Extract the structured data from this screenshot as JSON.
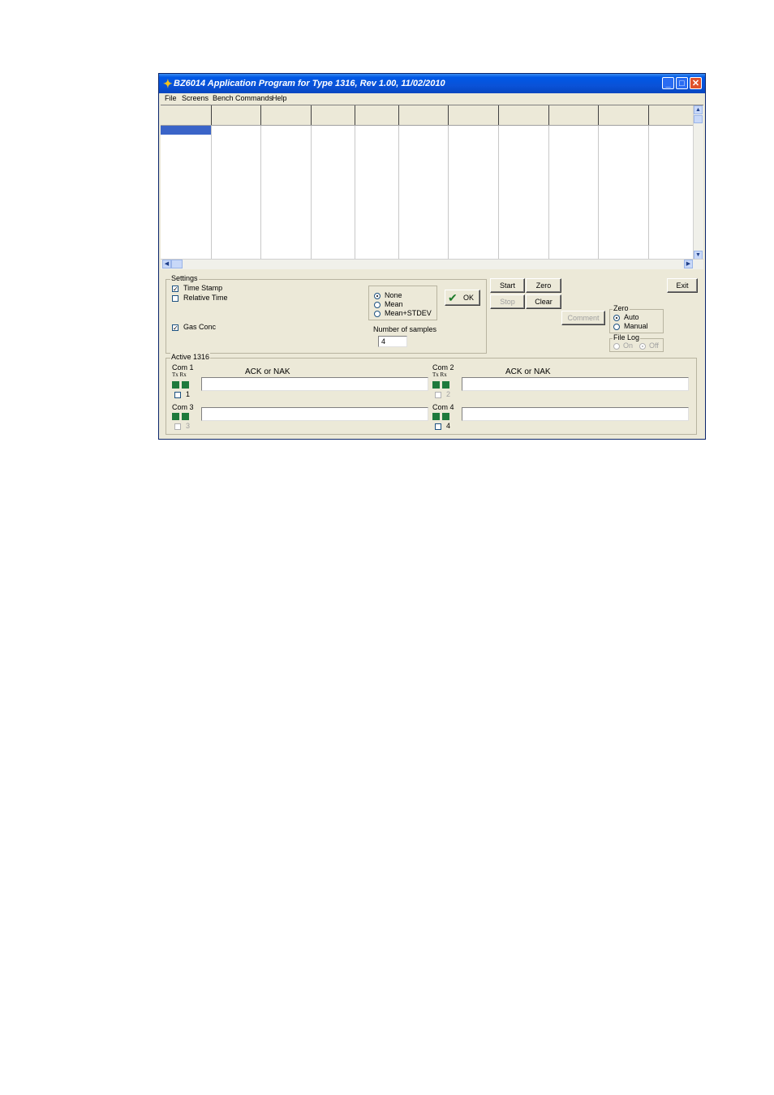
{
  "window": {
    "title": "BZ6014 Application Program for Type 1316, Rev 1.00, 11/02/2010",
    "controls": {
      "minimize": "_",
      "maximize": "□",
      "close": "✕"
    }
  },
  "menu": [
    "File",
    "Screens",
    "Bench Commands",
    "Help"
  ],
  "settings": {
    "title": "Settings",
    "time_stamp": "Time Stamp",
    "relative_time": "Relative Time",
    "gas_conc": "Gas Conc",
    "avg_options": [
      "None",
      "Mean",
      "Mean+STDEV"
    ],
    "samples_label": "Number of samples",
    "samples_value": "4",
    "ok": "OK"
  },
  "buttons": {
    "start": "Start",
    "zero": "Zero",
    "stop": "Stop",
    "clear": "Clear",
    "comment": "Comment",
    "exit": "Exit"
  },
  "zero_group": {
    "title": "Zero",
    "auto": "Auto",
    "manual": "Manual"
  },
  "file_log": {
    "title": "File Log",
    "on": "On",
    "off": "Off"
  },
  "active": {
    "title": "Active 1316",
    "txrx": "Tx Rx",
    "ack": "ACK or NAK",
    "com1": "Com 1",
    "com2": "Com 2",
    "com3": "Com 3",
    "com4": "Com 4",
    "n1": "1",
    "n2": "2",
    "n3": "3",
    "n4": "4"
  },
  "colors": {
    "led": "#1e7a3c",
    "selection": "#3a64c8",
    "title_bar": "#0a52d8"
  }
}
